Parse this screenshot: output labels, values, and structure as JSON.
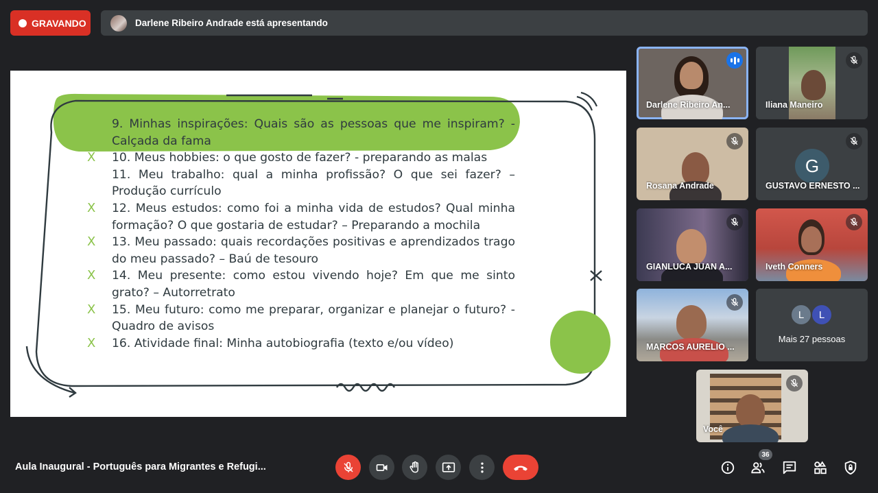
{
  "recording": {
    "label": "GRAVANDO"
  },
  "presenter": {
    "text": "Darlene Ribeiro Andrade está apresentando"
  },
  "slide": {
    "items": [
      {
        "mark": "",
        "text": "9. Minhas inspirações: Quais são as pessoas que me inspiram? - Calçada da fama"
      },
      {
        "mark": "X",
        "text": "10. Meus hobbies: o que gosto de fazer? - preparando as malas"
      },
      {
        "mark": "",
        "text": "11. Meu trabalho: qual a minha profissão? O que sei fazer? – Produção currículo"
      },
      {
        "mark": "X",
        "text": "12. Meus estudos: como foi a minha vida de estudos? Qual minha formação? O que gostaria de estudar? – Preparando a mochila"
      },
      {
        "mark": "X",
        "text": "13. Meu passado: quais recordações positivas e aprendizados trago do meu passado? – Baú de tesouro"
      },
      {
        "mark": "X",
        "text": "14. Meu presente: como estou vivendo hoje? Em que me sinto grato? – Autorretrato"
      },
      {
        "mark": "X",
        "text": "15. Meu futuro: como me preparar, organizar e planejar o futuro? - Quadro de avisos"
      },
      {
        "mark": "X",
        "text": "16. Atividade final: Minha autobiografia (texto e/ou vídeo)"
      }
    ],
    "colors": {
      "highlight": "#8bc34a",
      "ink": "#2f3a3f"
    }
  },
  "participants": [
    {
      "name": "Darlene Ribeiro An...",
      "state": "speaking"
    },
    {
      "name": "Iliana Maneiro",
      "state": "muted"
    },
    {
      "name": "Rosana Andrade",
      "state": "muted"
    },
    {
      "name": "GUSTAVO ERNESTO ...",
      "state": "muted",
      "initial": "G"
    },
    {
      "name": "GIANLUCA JUAN A...",
      "state": "muted"
    },
    {
      "name": "Iveth Conners",
      "state": "muted"
    },
    {
      "name": "MARCOS AURELIO ...",
      "state": "muted"
    },
    {
      "more": "Mais 27 pessoas",
      "initials": [
        "L",
        "L"
      ]
    }
  ],
  "self_view": {
    "name": "Você"
  },
  "meeting": {
    "title": "Aula Inaugural - Português para Migrantes e Refugi..."
  },
  "controls": [
    "mic-off",
    "camera",
    "raise-hand",
    "present-screen",
    "more-options",
    "leave-call"
  ],
  "side_controls": [
    "info",
    "people",
    "chat",
    "activities",
    "host-controls"
  ],
  "people_count": "36",
  "colors": {
    "background": "#202124",
    "tile": "#3c4043",
    "danger": "#ea4335",
    "accent": "#8ab4f8"
  }
}
